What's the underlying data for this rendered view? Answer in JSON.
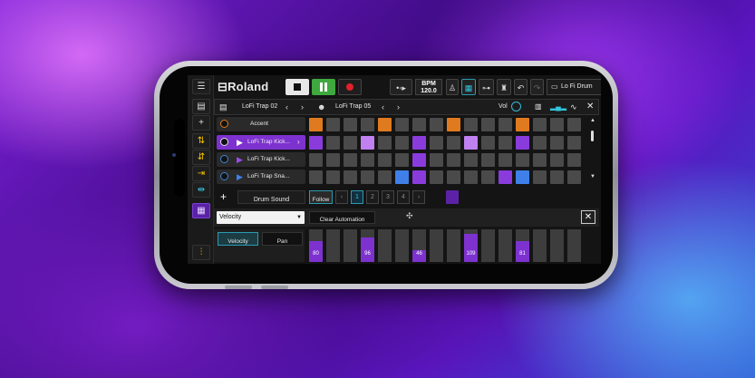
{
  "toolbar": {
    "brand": "Roland",
    "bpm_label": "BPM",
    "bpm_value": "120.0",
    "kit_name": "Lo Fi Drum"
  },
  "pattern_bar": {
    "pattern_a": "LoFi Trap 02",
    "pattern_b": "LoFi Trap 05",
    "vol_label": "Vol"
  },
  "tracks": [
    {
      "label": "Accent"
    },
    {
      "label": "LoFi Trap Kick..."
    },
    {
      "label": "LoFi Trap Kick..."
    },
    {
      "label": "LoFi Trap Sna..."
    }
  ],
  "grid": {
    "rows": [
      [
        "o",
        "d",
        "d",
        "d",
        "o",
        "d",
        "d",
        "d",
        "o",
        "d",
        "d",
        "d",
        "o",
        "d",
        "d",
        "d"
      ],
      [
        "p",
        "d",
        "d",
        "l",
        "d",
        "d",
        "p",
        "d",
        "d",
        "l",
        "d",
        "d",
        "p",
        "d",
        "d",
        "d"
      ],
      [
        "d",
        "d",
        "d",
        "d",
        "d",
        "d",
        "p",
        "d",
        "d",
        "d",
        "d",
        "d",
        "d",
        "d",
        "d",
        "d"
      ],
      [
        "d",
        "d",
        "d",
        "d",
        "d",
        "b",
        "p",
        "d",
        "d",
        "d",
        "d",
        "p",
        "b",
        "d",
        "d",
        "d"
      ]
    ]
  },
  "actions": {
    "drum_sound_label": "Drum Sound",
    "follow_label": "Follow",
    "pages": [
      "1",
      "2",
      "3",
      "4"
    ]
  },
  "automation": {
    "param_select": "Velocity",
    "clear_label": "Clear Automation"
  },
  "params": {
    "velocity_label": "Velocity",
    "pan_label": "Pan"
  },
  "velocity_values": [
    {
      "show": true,
      "text": "80",
      "level": 0.63
    },
    {
      "show": false,
      "text": "",
      "level": 0
    },
    {
      "show": false,
      "text": "",
      "level": 0
    },
    {
      "show": true,
      "text": "96",
      "level": 0.76
    },
    {
      "show": false,
      "text": "",
      "level": 0
    },
    {
      "show": false,
      "text": "",
      "level": 0
    },
    {
      "show": true,
      "text": "46",
      "level": 0.36
    },
    {
      "show": false,
      "text": "",
      "level": 0
    },
    {
      "show": false,
      "text": "",
      "level": 0
    },
    {
      "show": true,
      "text": "109",
      "level": 0.86
    },
    {
      "show": false,
      "text": "",
      "level": 0
    },
    {
      "show": false,
      "text": "",
      "level": 0
    },
    {
      "show": true,
      "text": "81",
      "level": 0.64
    },
    {
      "show": false,
      "text": "",
      "level": 0
    },
    {
      "show": false,
      "text": "",
      "level": 0
    },
    {
      "show": false,
      "text": "",
      "level": 0
    }
  ],
  "colors": {
    "orange": "#e07a1f",
    "purple": "#8a3bdc",
    "lilac": "#c080f0",
    "blue": "#3f7fe8",
    "dark": "#4a4a4a",
    "green": "#3fa83f",
    "record": "#e0202a"
  }
}
